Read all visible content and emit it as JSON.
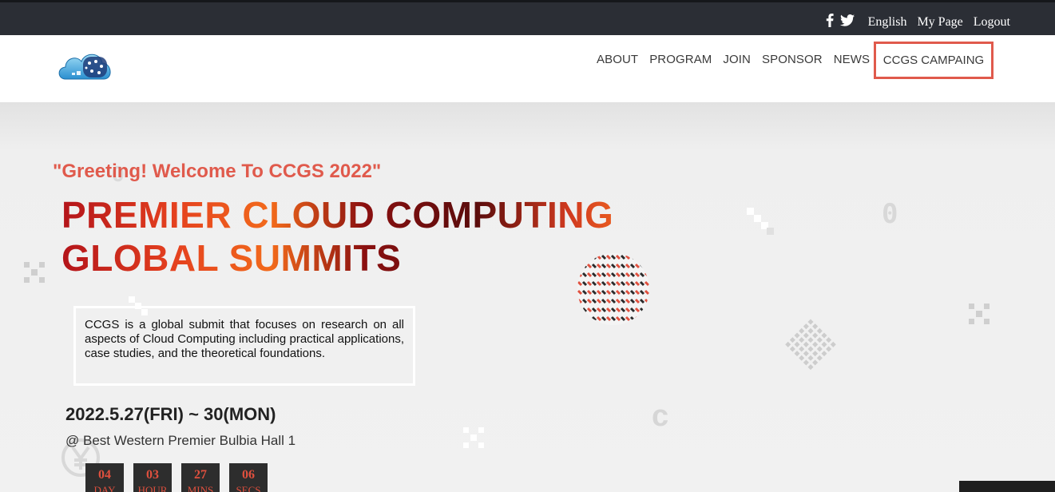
{
  "topbar": {
    "social": [
      "facebook-icon",
      "twitter-icon"
    ],
    "links": [
      "English",
      "My Page",
      "Logout"
    ]
  },
  "nav": {
    "items": [
      "ABOUT",
      "PROGRAM",
      "JOIN",
      "SPONSOR",
      "NEWS"
    ],
    "highlighted": "CCGS CAMPAING"
  },
  "hero": {
    "greeting": "\"Greeting! Welcome To CCGS 2022\"",
    "title_line1": "PREMIER CLOUD COMPUTING",
    "title_line2": "GLOBAL SUMMITS",
    "description": "CCGS is a global submit that focuses on research on all aspects of Cloud Computing including practical applications, case studies, and the theoretical foundations.",
    "date": "2022.5.27(FRI) ~ 30(MON)",
    "venue": "@ Best Western Premier Bulbia Hall 1"
  },
  "countdown": [
    {
      "value": "04",
      "label": "DAY"
    },
    {
      "value": "03",
      "label": "HOUR"
    },
    {
      "value": "27",
      "label": "MINS"
    },
    {
      "value": "06",
      "label": "SECS"
    }
  ],
  "colors": {
    "accent": "#e05a4c",
    "topbar": "#2b2e35",
    "countdown_bg": "#2d2d2d"
  }
}
